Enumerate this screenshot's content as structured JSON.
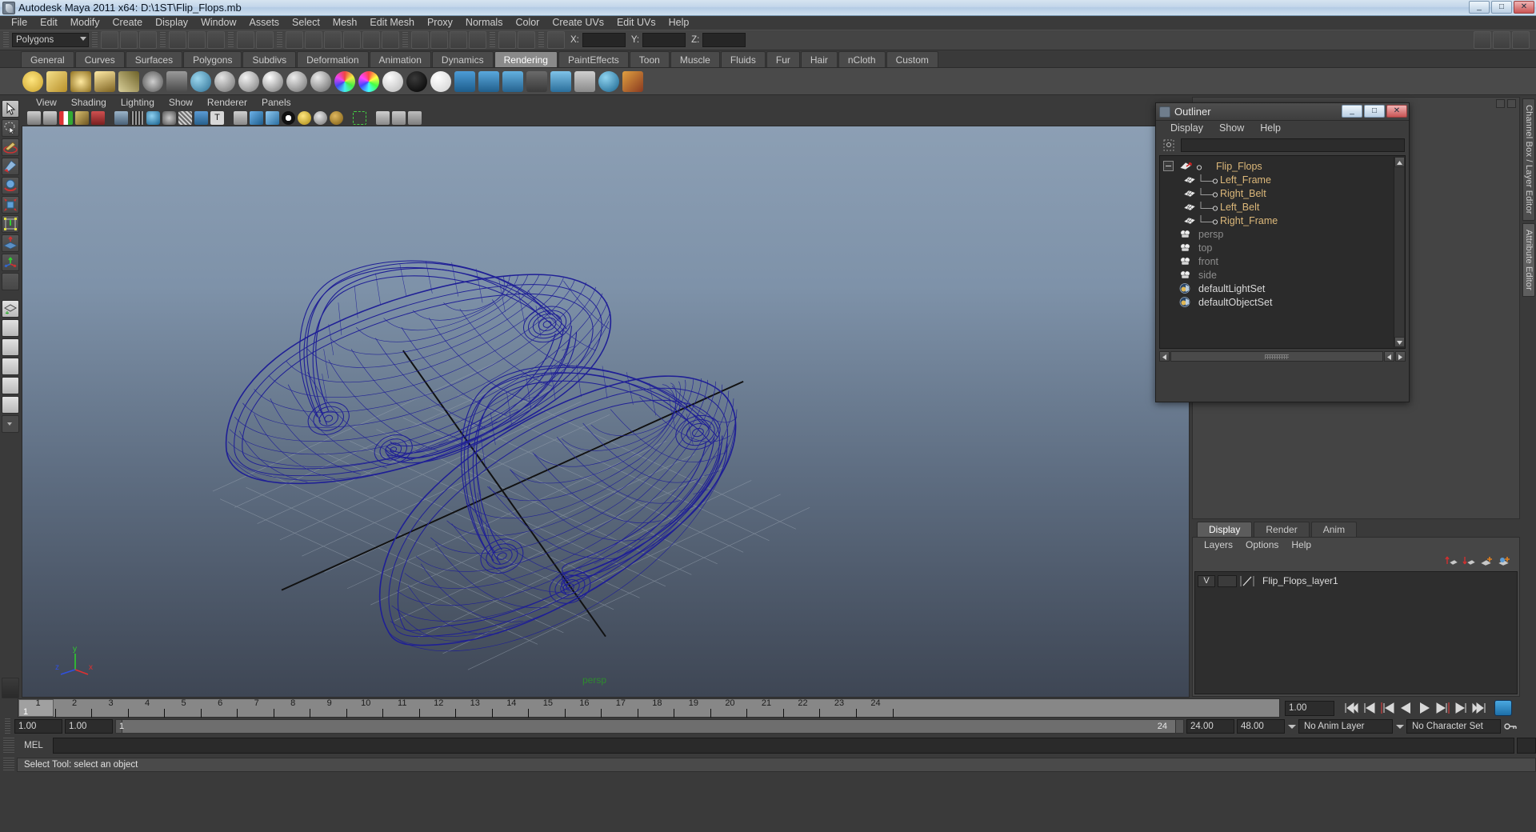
{
  "window": {
    "title": "Autodesk Maya 2011 x64: D:\\1ST\\Flip_Flops.mb",
    "app_icon": "maya-icon",
    "minimize": "_",
    "maximize": "□",
    "close": "✕"
  },
  "menubar": {
    "items": [
      "File",
      "Edit",
      "Modify",
      "Create",
      "Display",
      "Window",
      "Assets",
      "Select",
      "Mesh",
      "Edit Mesh",
      "Proxy",
      "Normals",
      "Color",
      "Create UVs",
      "Edit UVs",
      "Help"
    ]
  },
  "statusline": {
    "menuset": "Polygons",
    "coord_labels": [
      "X:",
      "Y:",
      "Z:"
    ],
    "coord_values": [
      "",
      "",
      ""
    ]
  },
  "shelf": {
    "tabs": [
      "General",
      "Curves",
      "Surfaces",
      "Polygons",
      "Subdivs",
      "Deformation",
      "Animation",
      "Dynamics",
      "Rendering",
      "PaintEffects",
      "Toon",
      "Muscle",
      "Fluids",
      "Fur",
      "Hair",
      "nCloth",
      "Custom"
    ],
    "active_tab": "Rendering"
  },
  "viewport": {
    "menu": [
      "View",
      "Shading",
      "Lighting",
      "Show",
      "Renderer",
      "Panels"
    ],
    "camera_label": "persp",
    "axis": {
      "x": "x",
      "y": "y",
      "z": "z"
    },
    "bg_top": "#8c9fb4",
    "bg_bottom": "#3e4654",
    "wireframe_color": "#1f1f96",
    "grid_color": "#9aa4b0"
  },
  "outliner": {
    "title": "Outliner",
    "menu": [
      "Display",
      "Show",
      "Help"
    ],
    "search_value": "",
    "items": [
      {
        "label": "Flip_Flops",
        "type": "transform",
        "indent": 0,
        "expander": true,
        "color": "tan"
      },
      {
        "label": "Left_Frame",
        "type": "mesh",
        "indent": 1,
        "expander": false,
        "color": "tan"
      },
      {
        "label": "Right_Belt",
        "type": "mesh",
        "indent": 1,
        "expander": false,
        "color": "tan"
      },
      {
        "label": "Left_Belt",
        "type": "mesh",
        "indent": 1,
        "expander": false,
        "color": "tan"
      },
      {
        "label": "Right_Frame",
        "type": "mesh",
        "indent": 1,
        "expander": false,
        "color": "tan"
      },
      {
        "label": "persp",
        "type": "camera",
        "indent": 0,
        "expander": false,
        "color": "dim"
      },
      {
        "label": "top",
        "type": "camera",
        "indent": 0,
        "expander": false,
        "color": "dim"
      },
      {
        "label": "front",
        "type": "camera",
        "indent": 0,
        "expander": false,
        "color": "dim"
      },
      {
        "label": "side",
        "type": "camera",
        "indent": 0,
        "expander": false,
        "color": "dim"
      },
      {
        "label": "defaultLightSet",
        "type": "set",
        "indent": 0,
        "expander": false,
        "color": "white"
      },
      {
        "label": "defaultObjectSet",
        "type": "set",
        "indent": 0,
        "expander": false,
        "color": "white"
      }
    ],
    "win_buttons": {
      "minimize": "_",
      "maximize": "□",
      "close": "✕"
    }
  },
  "right_dock": {
    "vertical_tabs": [
      "Channel Box / Layer Editor",
      "Attribute Editor"
    ],
    "active_vertical_tab": "Attribute Editor"
  },
  "layer_editor": {
    "tabs": [
      "Display",
      "Render",
      "Anim"
    ],
    "active_tab": "Display",
    "menu": [
      "Layers",
      "Options",
      "Help"
    ],
    "layers": [
      {
        "visibility": "V",
        "state": "",
        "name": "Flip_Flops_layer1"
      }
    ]
  },
  "timeline": {
    "ticks": [
      1,
      2,
      3,
      4,
      5,
      6,
      7,
      8,
      9,
      10,
      11,
      12,
      13,
      14,
      15,
      16,
      17,
      18,
      19,
      20,
      21,
      22,
      23,
      24
    ],
    "current_frame": "1",
    "current_frame_field": "1.00",
    "playback_buttons": [
      "go-to-start",
      "step-back-key",
      "step-back-frame",
      "play-backwards",
      "play-forwards",
      "step-forward-frame",
      "step-forward-key",
      "go-to-end"
    ]
  },
  "range_slider": {
    "anim_start": "1.00",
    "anim_end": "1.00",
    "range_start_label": "1",
    "range_end_label": "24",
    "playback_end": "24.00",
    "anim_end_total": "48.00",
    "anim_layer": "No Anim Layer",
    "character_set": "No Character Set"
  },
  "command_line": {
    "language": "MEL",
    "value": ""
  },
  "help_line": {
    "text": "Select Tool: select an object"
  }
}
